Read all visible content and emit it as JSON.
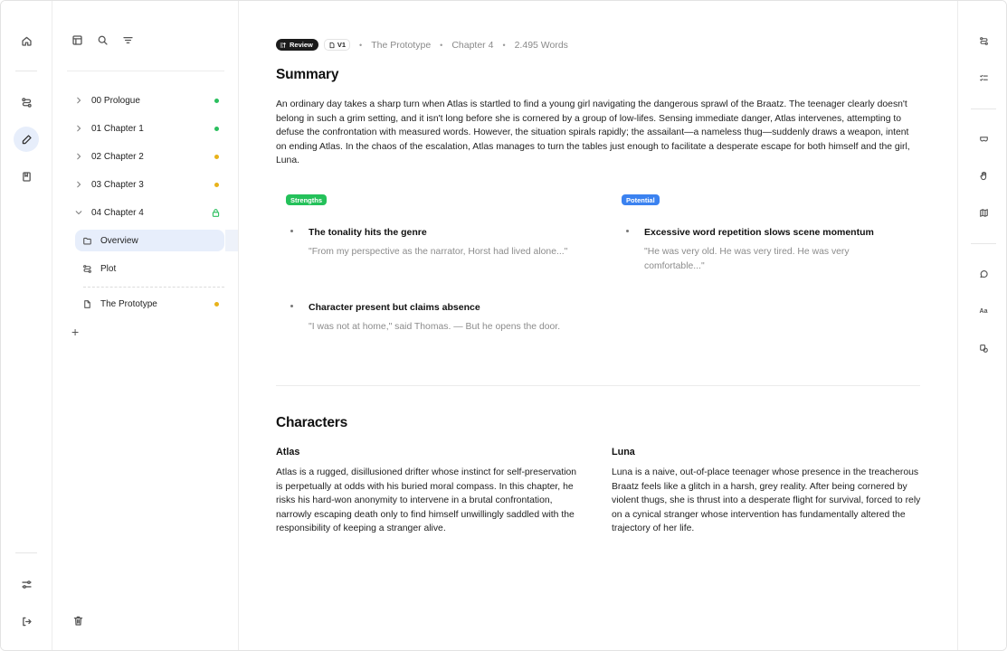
{
  "app": {
    "left_rail_icons": [
      "home-icon",
      "branch-icon",
      "pencil-icon",
      "notebook-icon",
      "sliders-icon",
      "logout-icon"
    ],
    "right_rail_icons": [
      "branch-icon",
      "checklist-icon",
      "mask-icon",
      "hand-icon",
      "map-icon",
      "chat-icon",
      "text-size-icon",
      "shapes-icon"
    ]
  },
  "tree": {
    "tool_icons": [
      "layout-icon",
      "search-icon",
      "filter-icon"
    ],
    "chapters": [
      {
        "label": "00  Prologue",
        "status_color": "#2bbf5e"
      },
      {
        "label": "01  Chapter 1",
        "status_color": "#2bbf5e"
      },
      {
        "label": "02  Chapter 2",
        "status_color": "#e8b21a"
      },
      {
        "label": "03  Chapter 3",
        "status_color": "#e8b21a"
      },
      {
        "label": "04  Chapter 4",
        "status_icon": "lock-icon",
        "expanded": true
      }
    ],
    "subitems": [
      {
        "label": "Overview",
        "icon": "folder-icon",
        "selected": true
      },
      {
        "label": "Plot",
        "icon": "branch-icon"
      }
    ],
    "document": {
      "label": "The Prototype",
      "icon": "document-icon",
      "status_color": "#e8b21a"
    },
    "add_label": "+",
    "trash_icon": "trash-icon"
  },
  "meta": {
    "review_label": "Review",
    "version_label": "V1",
    "book": "The Prototype",
    "chapter": "Chapter 4",
    "words": "2.495 Words",
    "separator": "•"
  },
  "summary": {
    "heading": "Summary",
    "text": "An ordinary day takes a sharp turn when Atlas is startled to find a young girl navigating the dangerous sprawl of the Braatz. The teenager clearly doesn't belong in such a grim setting, and it isn't long before she is cornered by a group of low-lifes. Sensing immediate danger, Atlas intervenes, attempting to defuse the confrontation with measured words. However, the situation spirals rapidly; the assailant—a nameless thug—suddenly draws a weapon, intent on ending Atlas. In the chaos of the escalation, Atlas manages to turn the tables just enough to facilitate a desperate escape for both himself and the girl, Luna."
  },
  "strengths": {
    "chip": "Strengths",
    "chip_color": "#24c15a",
    "items": [
      {
        "title": "The tonality hits the genre",
        "quote": "\"From my perspective as the narrator, Horst had lived alone...\""
      },
      {
        "title": "Character present but claims absence",
        "quote": "\"I was not at home,\" said Thomas. — But he opens the door."
      }
    ]
  },
  "potential": {
    "chip": "Potential",
    "chip_color": "#3b82f0",
    "items": [
      {
        "title": "Excessive word repetition slows scene momentum",
        "quote": "\"He was very old. He was very tired. He was very comfortable...\""
      }
    ]
  },
  "characters": {
    "heading": "Characters",
    "items": [
      {
        "name": "Atlas",
        "description": "Atlas is a rugged, disillusioned drifter whose instinct for self-preservation is perpetually at odds with his buried moral compass. In this chapter, he risks his hard-won anonymity to intervene in a brutal confrontation, narrowly escaping death only to find himself unwillingly saddled with the responsibility of keeping a stranger alive."
      },
      {
        "name": "Luna",
        "description": "Luna is a naive, out-of-place teenager whose presence in the treacherous Braatz feels like a glitch in a harsh, grey reality. After being cornered by violent thugs, she is thrust into a desperate flight for survival, forced to rely on a cynical stranger whose intervention has fundamentally altered the trajectory of her life."
      }
    ]
  },
  "right_rail": {
    "text_size_label": "Aa"
  }
}
